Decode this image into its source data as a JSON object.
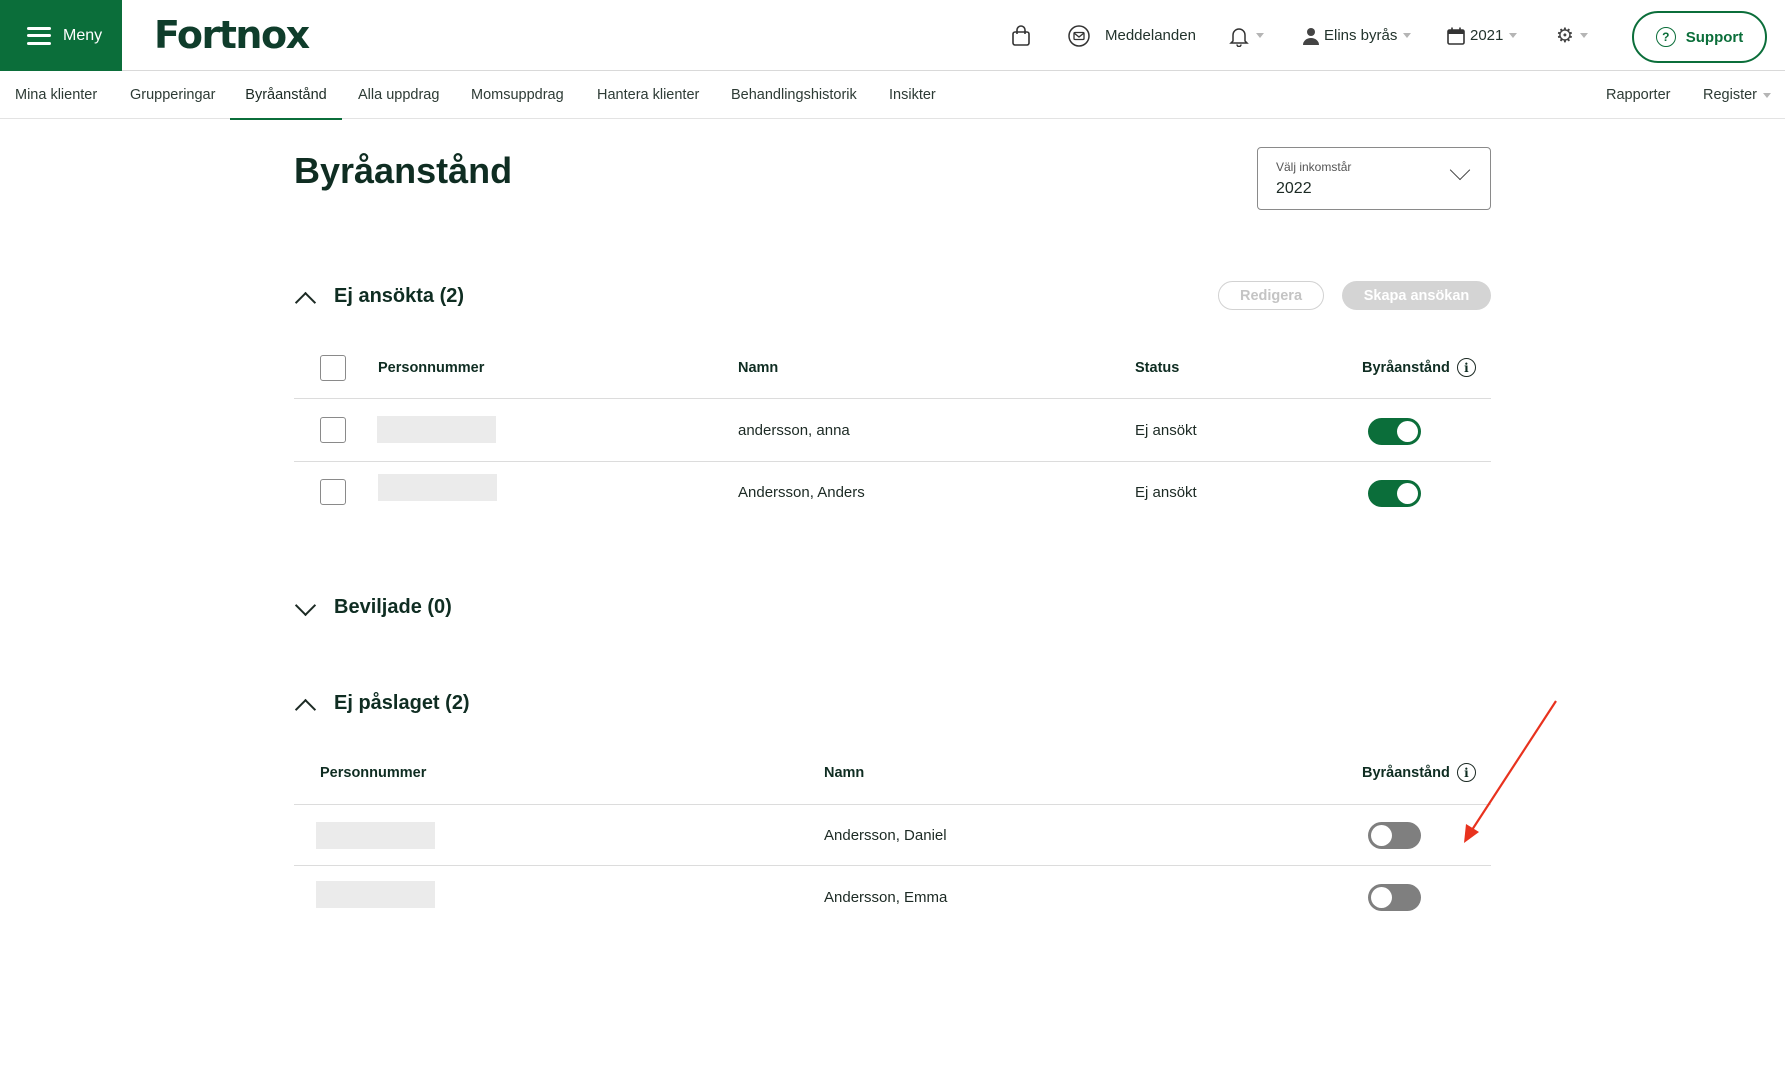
{
  "topbar": {
    "menu_label": "Meny",
    "logo_text": "Fortnox",
    "messages_label": "Meddelanden",
    "office_label": "Elins byrås",
    "year_label": "2021",
    "support_label": "Support",
    "icons": [
      "shopping-bag-icon",
      "envelope-icon",
      "bell-icon",
      "user-icon",
      "calendar-icon",
      "gear-icon",
      "question-icon"
    ]
  },
  "subnav": {
    "tabs": [
      {
        "label": "Mina klienter"
      },
      {
        "label": "Grupperingar"
      },
      {
        "label": "Byråanstånd",
        "active": true
      },
      {
        "label": "Alla uppdrag"
      },
      {
        "label": "Momsuppdrag"
      },
      {
        "label": "Hantera klienter"
      },
      {
        "label": "Behandlingshistorik"
      },
      {
        "label": "Insikter"
      }
    ],
    "right": {
      "reports": "Rapporter",
      "register": "Register"
    }
  },
  "main": {
    "page_title": "Byråanstånd",
    "income_year": {
      "label": "Välj inkomstår",
      "value": "2022"
    },
    "sections": {
      "not_applied": {
        "title": "Ej ansökta (2)",
        "expanded": true,
        "edit_label": "Redigera",
        "create_label": "Skapa ansökan",
        "columns": {
          "pnr": "Personnummer",
          "name": "Namn",
          "status": "Status",
          "deferral": "Byråanstånd"
        },
        "rows": [
          {
            "name": "andersson, anna",
            "status": "Ej ansökt",
            "deferral_on": true
          },
          {
            "name": "Andersson, Anders",
            "status": "Ej ansökt",
            "deferral_on": true
          }
        ]
      },
      "granted": {
        "title": "Beviljade (0)",
        "expanded": false
      },
      "not_enabled": {
        "title": "Ej påslaget (2)",
        "expanded": true,
        "columns": {
          "pnr": "Personnummer",
          "name": "Namn",
          "deferral": "Byråanstånd"
        },
        "rows": [
          {
            "name": "Andersson, Daniel",
            "deferral_on": false
          },
          {
            "name": "Andersson, Emma",
            "deferral_on": false
          }
        ]
      }
    }
  },
  "colors": {
    "brand": "#0b6e3a",
    "annotation": "#e8321e",
    "toggle_off": "#7f7f7f"
  }
}
